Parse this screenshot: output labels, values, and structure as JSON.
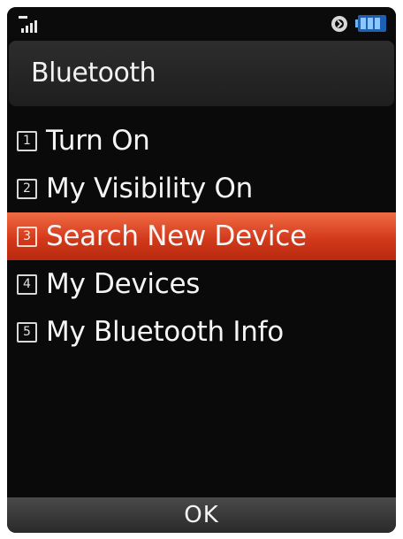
{
  "status_bar": {
    "signal_icon": "signal-strength-icon",
    "sync_icon": "bluetooth-sync-icon",
    "battery_icon": "battery-icon"
  },
  "header": {
    "title": "Bluetooth"
  },
  "menu": {
    "items": [
      {
        "number": "1",
        "label": "Turn On"
      },
      {
        "number": "2",
        "label": "My Visibility On"
      },
      {
        "number": "3",
        "label": "Search New Device"
      },
      {
        "number": "4",
        "label": "My Devices"
      },
      {
        "number": "5",
        "label": "My Bluetooth Info"
      }
    ],
    "selected_index": 2
  },
  "softkey": {
    "ok_label": "OK"
  },
  "colors": {
    "background": "#0a0a0a",
    "highlight": "#d33a1c",
    "text": "#f5f5f5",
    "battery": "#3f8fe0"
  }
}
